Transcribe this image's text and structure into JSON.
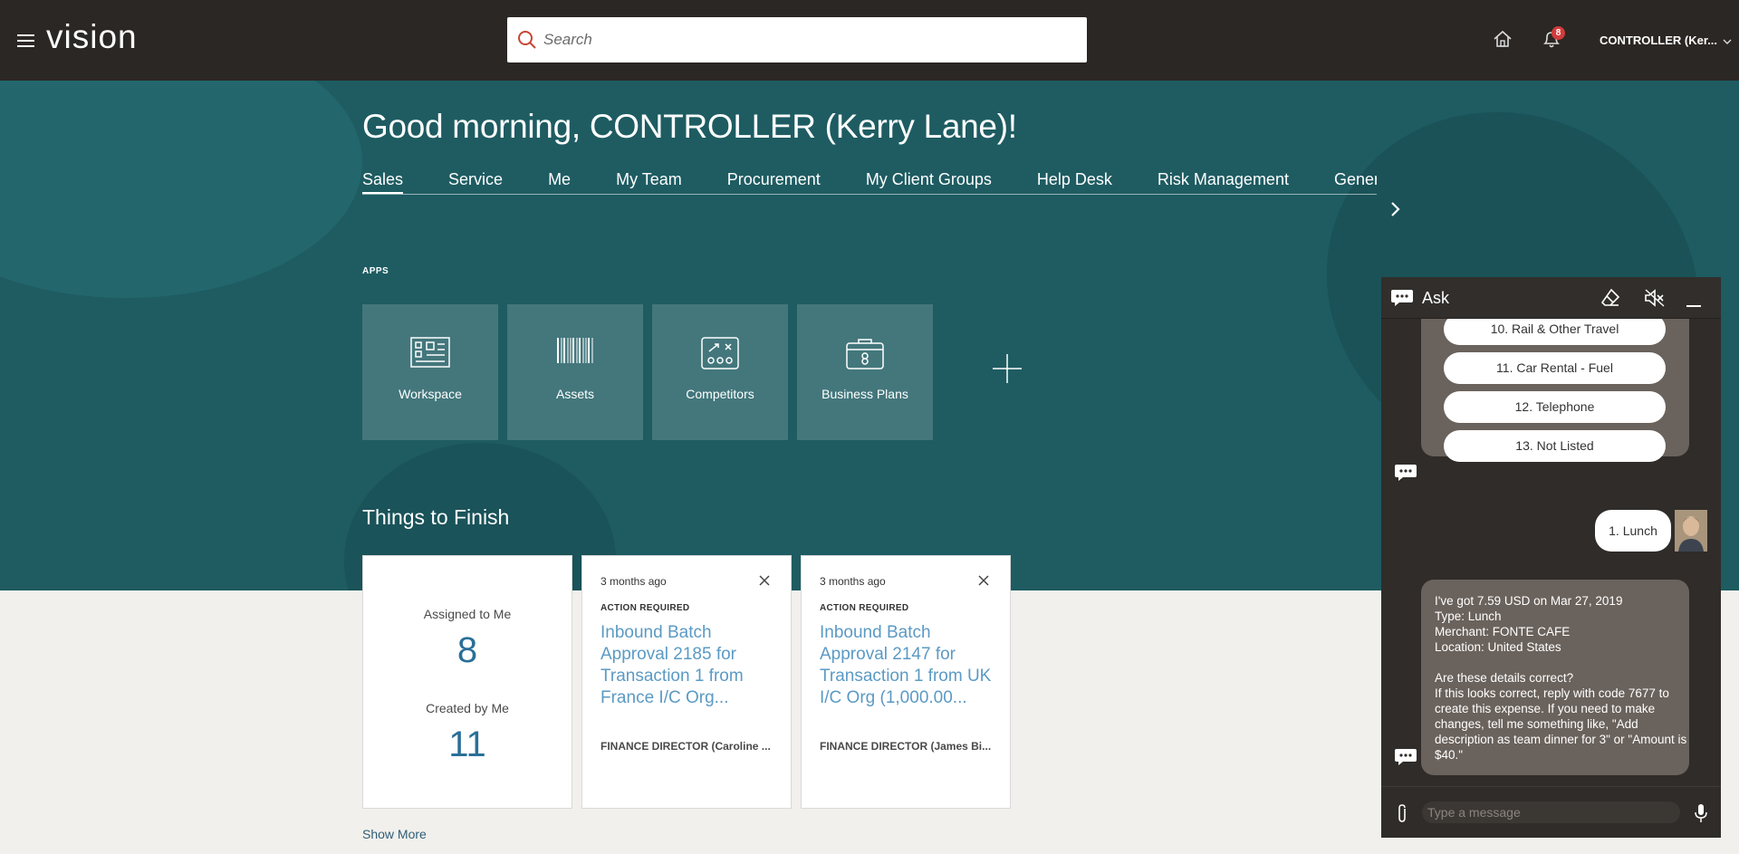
{
  "header": {
    "logo": "vision",
    "search_placeholder": "Search",
    "notification_count": "8",
    "user_label": "CONTROLLER (Ker..."
  },
  "hero": {
    "greeting": "Good morning, CONTROLLER (Kerry Lane)!",
    "tabs": [
      "Sales",
      "Service",
      "Me",
      "My Team",
      "Procurement",
      "My Client Groups",
      "Help Desk",
      "Risk Management",
      "Genera"
    ],
    "active_tab": "Sales",
    "apps_label": "APPS",
    "apps": [
      {
        "name": "Workspace",
        "icon": "workspace-icon"
      },
      {
        "name": "Assets",
        "icon": "barcode-icon"
      },
      {
        "name": "Competitors",
        "icon": "competitors-icon"
      },
      {
        "name": "Business Plans",
        "icon": "business-plans-icon"
      }
    ],
    "things_title": "Things to Finish"
  },
  "summary": {
    "assigned_label": "Assigned to Me",
    "assigned_count": "8",
    "created_label": "Created by Me",
    "created_count": "11"
  },
  "tasks": [
    {
      "time": "3 months ago",
      "status": "ACTION REQUIRED",
      "title": "Inbound Batch Approval 2185 for Transaction 1 from France I/C Org...",
      "from": "FINANCE DIRECTOR (Caroline ..."
    },
    {
      "time": "3 months ago",
      "status": "ACTION REQUIRED",
      "title": "Inbound Batch Approval 2147 for Transaction 1 from UK I/C Org (1,000.00...",
      "from": "FINANCE DIRECTOR (James Bi..."
    }
  ],
  "show_more": "Show More",
  "chat": {
    "title": "Ask",
    "options": [
      "10. Rail & Other Travel",
      "11. Car Rental - Fuel",
      "12. Telephone",
      "13. Not Listed"
    ],
    "user_message": "1. Lunch",
    "bot_reply": "I've got 7.59 USD on Mar 27, 2019\nType: Lunch\nMerchant: FONTE CAFE\nLocation: United States\n\nAre these details correct?\nIf this looks correct, reply with code 7677 to create this expense. If you need to make changes, tell me something like, \"Add description as team dinner for 3\" or \"Amount is $40.\"",
    "input_placeholder": "Type a message"
  }
}
